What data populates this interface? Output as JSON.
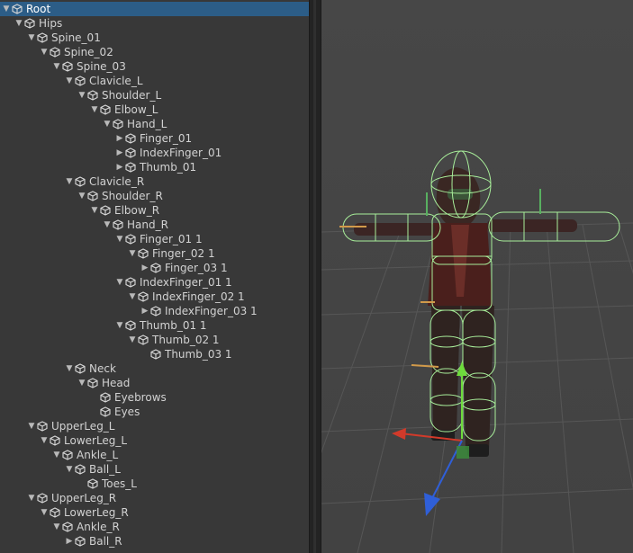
{
  "hierarchy": {
    "items": [
      {
        "label": "Root",
        "depth": 0,
        "expander": "expanded",
        "selected": true
      },
      {
        "label": "Hips",
        "depth": 1,
        "expander": "expanded"
      },
      {
        "label": "Spine_01",
        "depth": 2,
        "expander": "expanded"
      },
      {
        "label": "Spine_02",
        "depth": 3,
        "expander": "expanded"
      },
      {
        "label": "Spine_03",
        "depth": 4,
        "expander": "expanded"
      },
      {
        "label": "Clavicle_L",
        "depth": 5,
        "expander": "expanded"
      },
      {
        "label": "Shoulder_L",
        "depth": 6,
        "expander": "expanded"
      },
      {
        "label": "Elbow_L",
        "depth": 7,
        "expander": "expanded"
      },
      {
        "label": "Hand_L",
        "depth": 8,
        "expander": "expanded"
      },
      {
        "label": "Finger_01",
        "depth": 9,
        "expander": "collapsed"
      },
      {
        "label": "IndexFinger_01",
        "depth": 9,
        "expander": "collapsed"
      },
      {
        "label": "Thumb_01",
        "depth": 9,
        "expander": "collapsed"
      },
      {
        "label": "Clavicle_R",
        "depth": 5,
        "expander": "expanded"
      },
      {
        "label": "Shoulder_R",
        "depth": 6,
        "expander": "expanded"
      },
      {
        "label": "Elbow_R",
        "depth": 7,
        "expander": "expanded"
      },
      {
        "label": "Hand_R",
        "depth": 8,
        "expander": "expanded"
      },
      {
        "label": "Finger_01 1",
        "depth": 9,
        "expander": "expanded"
      },
      {
        "label": "Finger_02 1",
        "depth": 10,
        "expander": "expanded"
      },
      {
        "label": "Finger_03 1",
        "depth": 11,
        "expander": "collapsed"
      },
      {
        "label": "IndexFinger_01 1",
        "depth": 9,
        "expander": "expanded"
      },
      {
        "label": "IndexFinger_02 1",
        "depth": 10,
        "expander": "expanded"
      },
      {
        "label": "IndexFinger_03 1",
        "depth": 11,
        "expander": "collapsed"
      },
      {
        "label": "Thumb_01 1",
        "depth": 9,
        "expander": "expanded"
      },
      {
        "label": "Thumb_02 1",
        "depth": 10,
        "expander": "expanded"
      },
      {
        "label": "Thumb_03 1",
        "depth": 11,
        "expander": "none"
      },
      {
        "label": "Neck",
        "depth": 5,
        "expander": "expanded"
      },
      {
        "label": "Head",
        "depth": 6,
        "expander": "expanded"
      },
      {
        "label": "Eyebrows",
        "depth": 7,
        "expander": "none"
      },
      {
        "label": "Eyes",
        "depth": 7,
        "expander": "none"
      },
      {
        "label": "UpperLeg_L",
        "depth": 2,
        "expander": "expanded"
      },
      {
        "label": "LowerLeg_L",
        "depth": 3,
        "expander": "expanded"
      },
      {
        "label": "Ankle_L",
        "depth": 4,
        "expander": "expanded"
      },
      {
        "label": "Ball_L",
        "depth": 5,
        "expander": "expanded"
      },
      {
        "label": "Toes_L",
        "depth": 6,
        "expander": "none"
      },
      {
        "label": "UpperLeg_R",
        "depth": 2,
        "expander": "expanded"
      },
      {
        "label": "LowerLeg_R",
        "depth": 3,
        "expander": "expanded"
      },
      {
        "label": "Ankle_R",
        "depth": 4,
        "expander": "expanded"
      },
      {
        "label": "Ball_R",
        "depth": 5,
        "expander": "collapsed"
      }
    ]
  },
  "icons": {
    "expanded": "triangle-down-icon",
    "collapsed": "triangle-right-icon",
    "node": "gameobject-cube-icon"
  },
  "colors": {
    "panel_bg": "#383838",
    "selection": "#2c5d87",
    "viewport_bg": "#444444",
    "collider_wire": "#a8ee9a",
    "gizmo_x": "#d23a2a",
    "gizmo_y": "#6edb3c",
    "gizmo_z": "#2f5fd8"
  }
}
